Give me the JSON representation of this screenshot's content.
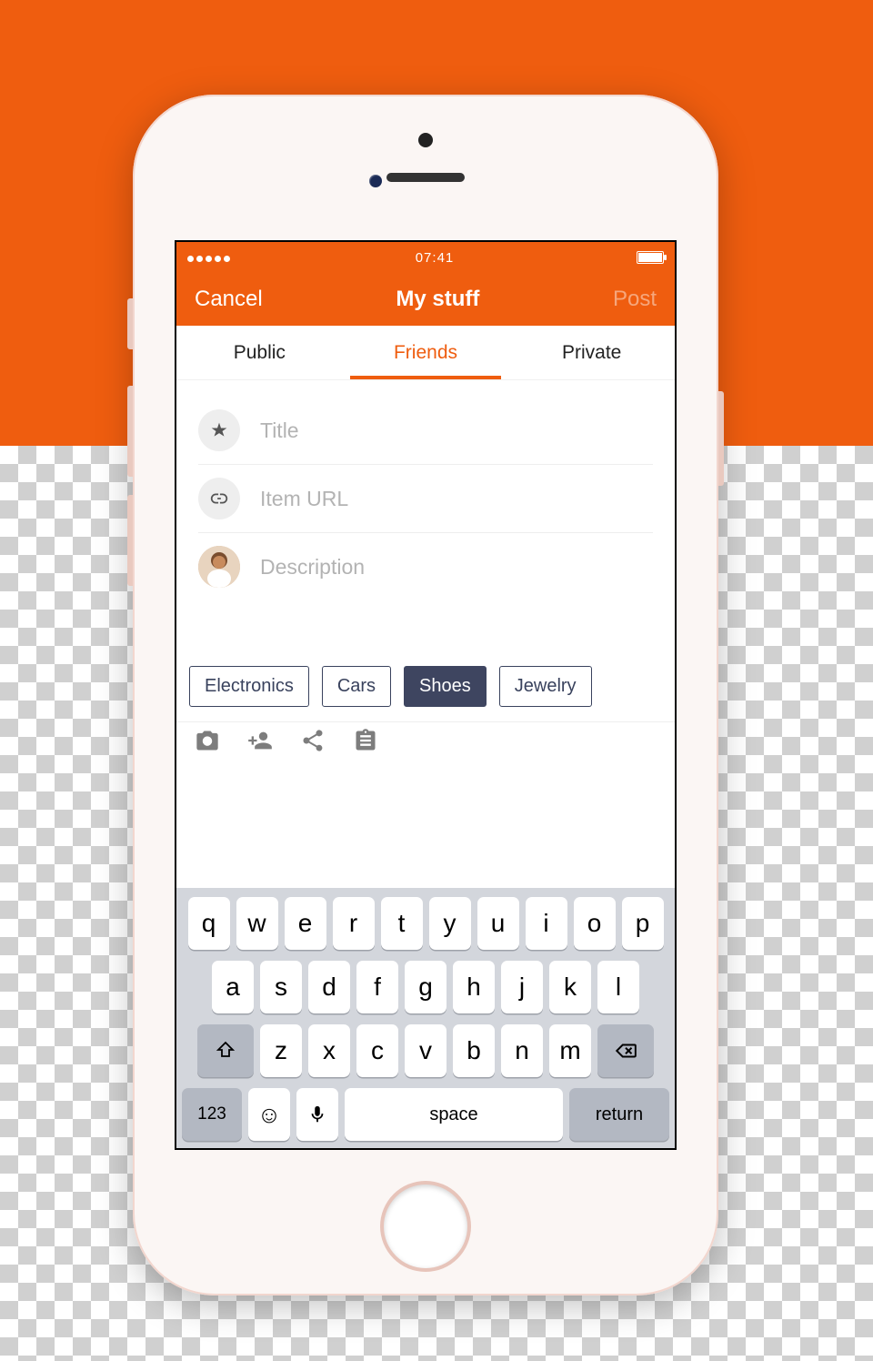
{
  "statusbar": {
    "time": "07:41"
  },
  "navbar": {
    "cancel": "Cancel",
    "title": "My stuff",
    "post": "Post"
  },
  "tabs": [
    {
      "label": "Public",
      "active": false
    },
    {
      "label": "Friends",
      "active": true
    },
    {
      "label": "Private",
      "active": false
    }
  ],
  "fields": {
    "title_placeholder": "Title",
    "url_placeholder": "Item URL",
    "description_placeholder": "Description"
  },
  "tags": [
    {
      "label": "Electronics",
      "selected": false
    },
    {
      "label": "Cars",
      "selected": false
    },
    {
      "label": "Shoes",
      "selected": true
    },
    {
      "label": "Jewelry",
      "selected": false
    }
  ],
  "keyboard": {
    "row1": [
      "q",
      "w",
      "e",
      "r",
      "t",
      "y",
      "u",
      "i",
      "o",
      "p"
    ],
    "row2": [
      "a",
      "s",
      "d",
      "f",
      "g",
      "h",
      "j",
      "k",
      "l"
    ],
    "row3": [
      "z",
      "x",
      "c",
      "v",
      "b",
      "n",
      "m"
    ],
    "numbers": "123",
    "space": "space",
    "return": "return"
  }
}
